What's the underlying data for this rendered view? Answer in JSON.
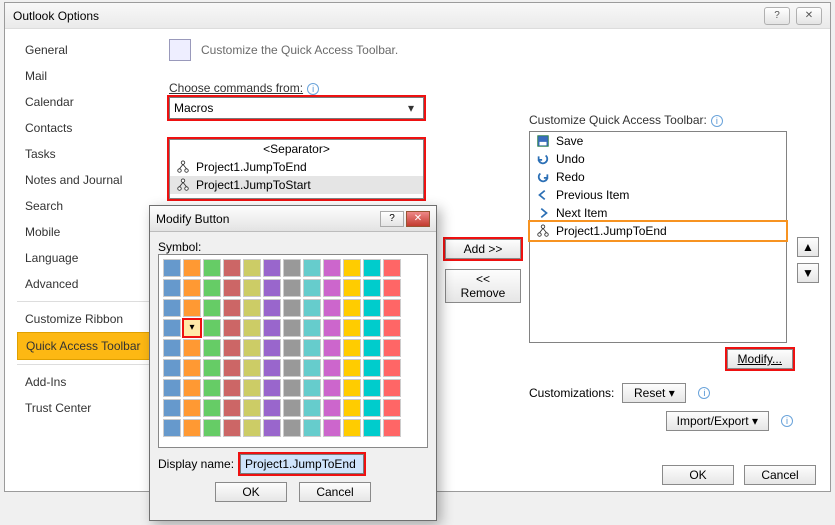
{
  "window": {
    "title": "Outlook Options"
  },
  "sidebar": {
    "items": [
      {
        "label": "General"
      },
      {
        "label": "Mail"
      },
      {
        "label": "Calendar"
      },
      {
        "label": "Contacts"
      },
      {
        "label": "Tasks"
      },
      {
        "label": "Notes and Journal"
      },
      {
        "label": "Search"
      },
      {
        "label": "Mobile"
      },
      {
        "label": "Language"
      },
      {
        "label": "Advanced"
      },
      {
        "label": "Customize Ribbon"
      },
      {
        "label": "Quick Access Toolbar"
      },
      {
        "label": "Add-Ins"
      },
      {
        "label": "Trust Center"
      }
    ],
    "selected_index": 11
  },
  "main": {
    "heading": "Customize the Quick Access Toolbar.",
    "choose_label": "Choose commands from:",
    "choose_value": "Macros",
    "left_list": {
      "separator": "<Separator>",
      "items": [
        {
          "icon": "macro-tree-icon",
          "label": "Project1.JumpToEnd"
        },
        {
          "icon": "macro-tree-icon",
          "label": "Project1.JumpToStart"
        }
      ],
      "selected_index": 1
    },
    "right_label": "Customize Quick Access Toolbar:",
    "right_list": {
      "items": [
        {
          "icon": "save-icon",
          "label": "Save"
        },
        {
          "icon": "undo-icon",
          "label": "Undo"
        },
        {
          "icon": "redo-icon",
          "label": "Redo"
        },
        {
          "icon": "previous-icon",
          "label": "Previous Item"
        },
        {
          "icon": "next-icon",
          "label": "Next Item"
        },
        {
          "icon": "macro-tree-icon",
          "label": "Project1.JumpToEnd"
        }
      ],
      "highlight_index": 5
    },
    "buttons": {
      "add": "Add >>",
      "remove": "<< Remove",
      "modify": "Modify...",
      "reset": "Reset ▾",
      "import_export": "Import/Export ▾",
      "customizations_label": "Customizations:",
      "ok": "OK",
      "cancel": "Cancel"
    }
  },
  "dialog": {
    "title": "Modify Button",
    "symbol_label": "Symbol:",
    "display_label": "Display name:",
    "display_value": "Project1.JumpToEnd",
    "ok": "OK",
    "cancel": "Cancel",
    "highlighted_icon_index": 37
  }
}
